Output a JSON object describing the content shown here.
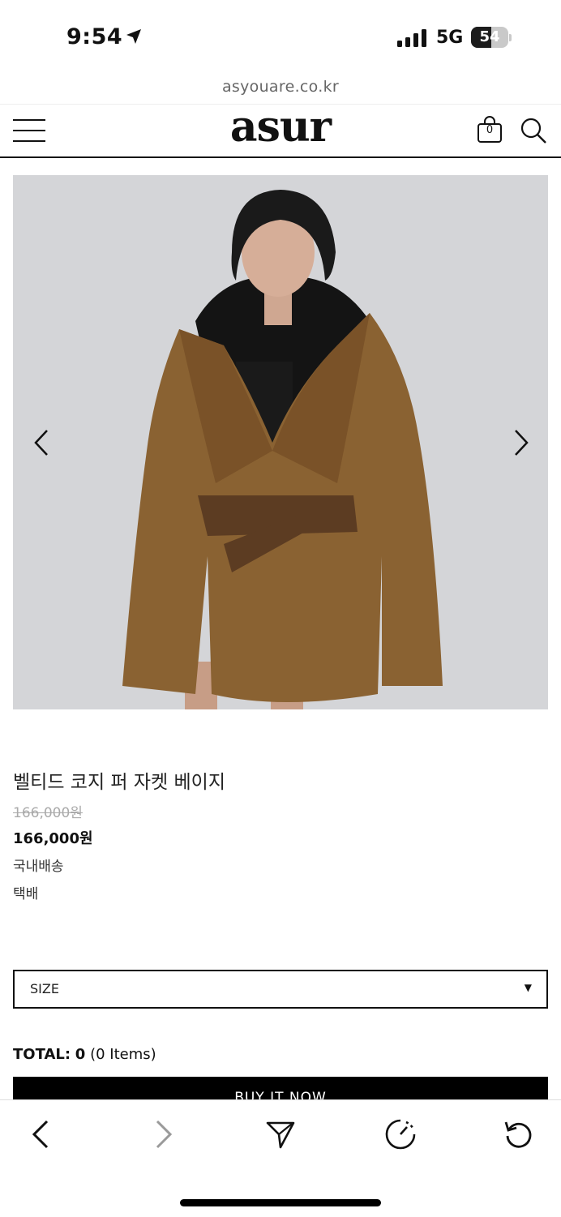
{
  "status": {
    "time": "9:54",
    "network": "5G",
    "battery": "54",
    "battery_level": 0.54
  },
  "browser": {
    "url": "asyouare.co.kr"
  },
  "header": {
    "logo": "asur",
    "cart_count": "0"
  },
  "product": {
    "name": "벨티드 코지 퍼 자켓 베이지",
    "original_price": "166,000원",
    "price": "166,000원",
    "shipping_region": "국내배송",
    "shipping_method": "택배"
  },
  "options": {
    "size_label": "SIZE"
  },
  "total": {
    "label": "TOTAL:",
    "value": "0",
    "items": "(0 Items)"
  },
  "actions": {
    "buy_now": "BUY IT NOW"
  },
  "icons": {
    "menu": "hamburger-menu-icon",
    "cart": "shopping-bag-icon",
    "search": "search-icon",
    "prev_image": "chevron-left-icon",
    "next_image": "chevron-right-icon",
    "back": "back-arrow-icon",
    "forward": "forward-arrow-icon",
    "share": "send-icon",
    "speed": "speedometer-icon",
    "reload": "reload-icon"
  },
  "colors": {
    "accent": "#000000",
    "muted_price": "#aaaaaa",
    "image_background": "#d4d5d8",
    "fur": "#8a6232"
  }
}
